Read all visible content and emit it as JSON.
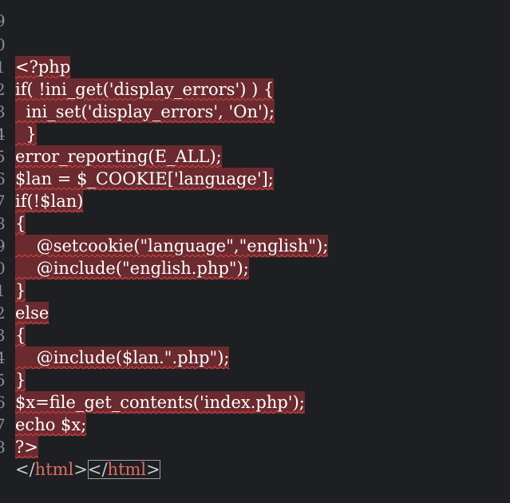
{
  "lines": [
    {
      "num": "9",
      "text": ""
    },
    {
      "num": "0",
      "text": "<?php"
    },
    {
      "num": "1",
      "text": "if( !ini_get('display_errors') ) {"
    },
    {
      "num": "2",
      "text": "  ini_set('display_errors', 'On');"
    },
    {
      "num": "3",
      "text": "  }"
    },
    {
      "num": "4",
      "text": "error_reporting(E_ALL);"
    },
    {
      "num": "5",
      "text": "$lan = $_COOKIE['language'];"
    },
    {
      "num": "6",
      "text": "if(!$lan)"
    },
    {
      "num": "7",
      "text": "{"
    },
    {
      "num": "8",
      "text": "    @setcookie(\"language\",\"english\");"
    },
    {
      "num": "9",
      "text": "    @include(\"english.php\");"
    },
    {
      "num": "0",
      "text": "}"
    },
    {
      "num": "1",
      "text": "else"
    },
    {
      "num": "2",
      "text": "{"
    },
    {
      "num": "3",
      "text": "    @include($lan.\".php\");"
    },
    {
      "num": "4",
      "text": "}"
    },
    {
      "num": "5",
      "text": "$x=file_get_contents('index.php');"
    },
    {
      "num": "6",
      "text": "echo $x;"
    },
    {
      "num": "7",
      "text": "?>"
    },
    {
      "num": "8",
      "text": ""
    }
  ],
  "last_line": {
    "open_bracket": "</",
    "name1": "html",
    "close_bracket": ">",
    "open_bracket2": "</",
    "name2": "html",
    "close_bracket2": ">"
  },
  "colors": {
    "background": "#1e1f22",
    "highlight": "#6b2a2f",
    "squiggle": "#e0443e",
    "tag_name": "#e06c64"
  }
}
